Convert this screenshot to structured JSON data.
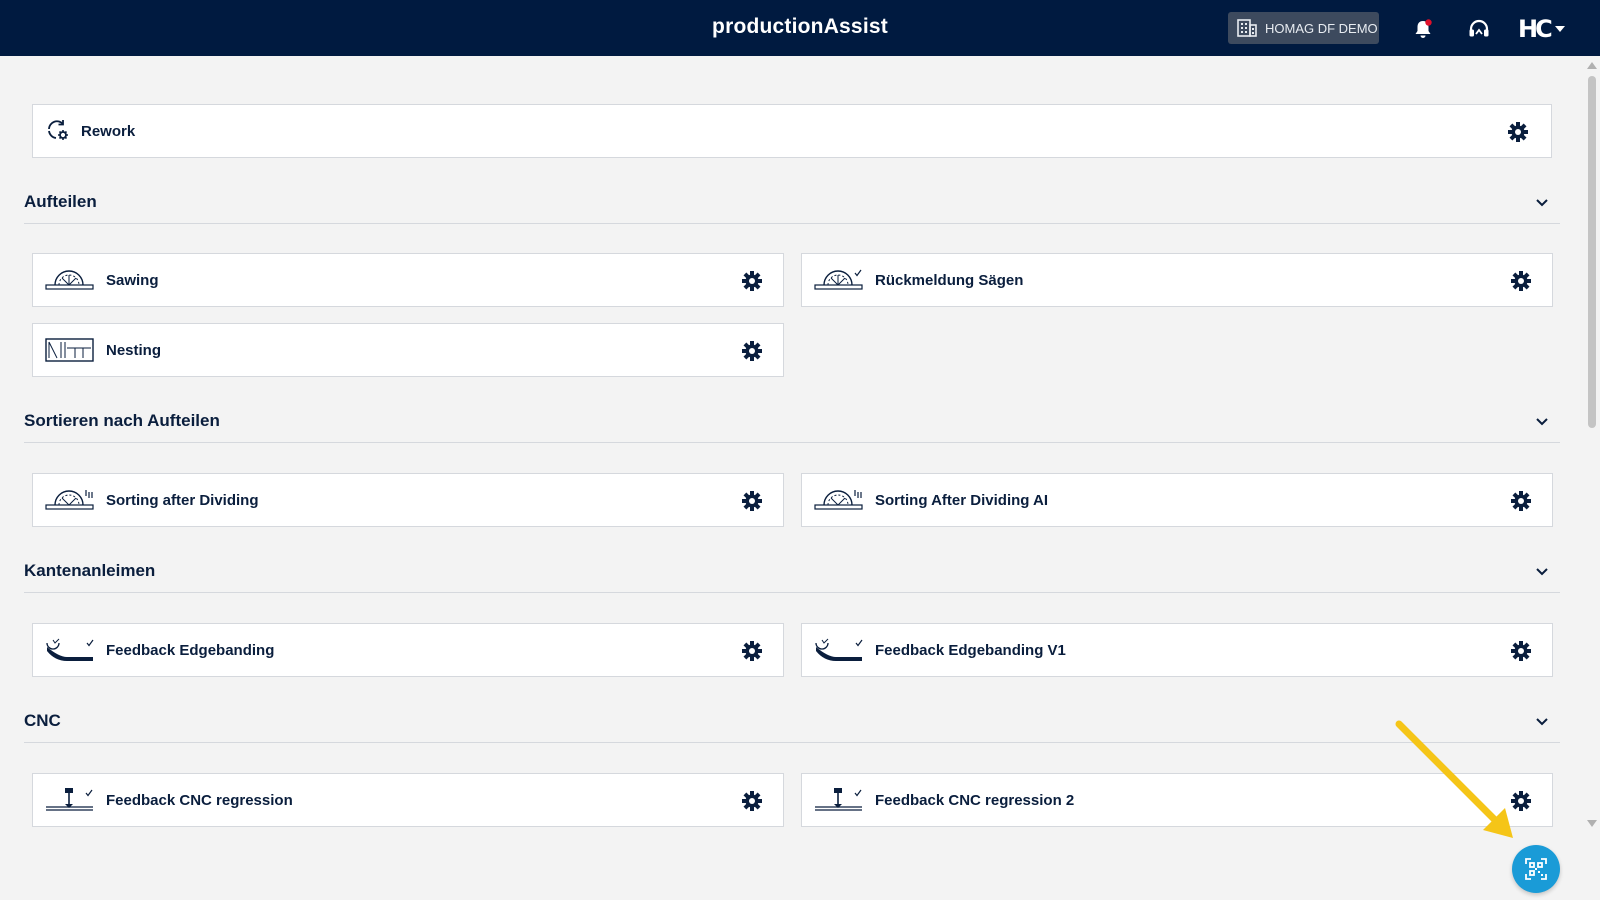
{
  "header": {
    "app_title": "productionAssist",
    "tenant_label": "HOMAG DF DEMO",
    "user_logo": "HC"
  },
  "rework_card": {
    "label": "Rework",
    "icon": "rework-icon"
  },
  "sections": [
    {
      "title": "Aufteilen",
      "cards": [
        {
          "label": "Sawing",
          "icon": "saw-icon"
        },
        {
          "label": "Rückmeldung Sägen",
          "icon": "saw-feedback-icon"
        },
        {
          "label": "Nesting",
          "icon": "nesting-icon"
        }
      ]
    },
    {
      "title": "Sortieren nach Aufteilen",
      "cards": [
        {
          "label": "Sorting after Dividing",
          "icon": "sorting-icon"
        },
        {
          "label": "Sorting After Dividing AI",
          "icon": "sorting-icon"
        }
      ]
    },
    {
      "title": "Kantenanleimen",
      "cards": [
        {
          "label": "Feedback Edgebanding",
          "icon": "edgebanding-icon"
        },
        {
          "label": "Feedback Edgebanding V1",
          "icon": "edgebanding-icon"
        }
      ]
    },
    {
      "title": "CNC",
      "cards": [
        {
          "label": "Feedback CNC regression",
          "icon": "cnc-icon"
        },
        {
          "label": "Feedback CNC regression 2",
          "icon": "cnc-icon"
        }
      ]
    }
  ],
  "colors": {
    "topbar": "#001a40",
    "accent": "#1a9bd7",
    "annotation_arrow": "#f5c518",
    "notification_dot": "#e0102a"
  }
}
